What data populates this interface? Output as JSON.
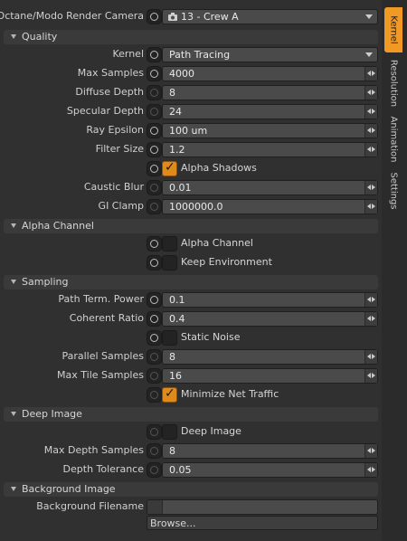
{
  "camera": {
    "label": "Octane/Modo Render Camera",
    "value": "13 - Crew A",
    "icon": "camera-icon"
  },
  "sections": {
    "quality": "Quality",
    "alpha_channel": "Alpha Channel",
    "sampling": "Sampling",
    "deep_image": "Deep Image",
    "background_image": "Background Image"
  },
  "quality": {
    "kernel": {
      "label": "Kernel",
      "value": "Path Tracing"
    },
    "max_samples": {
      "label": "Max Samples",
      "value": "4000"
    },
    "diffuse_depth": {
      "label": "Diffuse Depth",
      "value": "8"
    },
    "specular_depth": {
      "label": "Specular Depth",
      "value": "24"
    },
    "ray_epsilon": {
      "label": "Ray Epsilon",
      "value": "100 um"
    },
    "filter_size": {
      "label": "Filter Size",
      "value": "1.2"
    },
    "alpha_shadows": {
      "label": "Alpha Shadows",
      "checked": true
    },
    "caustic_blur": {
      "label": "Caustic Blur",
      "value": "0.01"
    },
    "gi_clamp": {
      "label": "GI Clamp",
      "value": "1000000.0"
    }
  },
  "alpha_channel": {
    "alpha_channel": {
      "label": "Alpha Channel",
      "checked": false
    },
    "keep_environment": {
      "label": "Keep Environment",
      "checked": false
    }
  },
  "sampling": {
    "path_term_power": {
      "label": "Path Term. Power",
      "value": "0.1"
    },
    "coherent_ratio": {
      "label": "Coherent Ratio",
      "value": "0.4"
    },
    "static_noise": {
      "label": "Static Noise",
      "checked": false
    },
    "parallel_samples": {
      "label": "Parallel Samples",
      "value": "8"
    },
    "max_tile_samples": {
      "label": "Max Tile Samples",
      "value": "16"
    },
    "minimize_net_traffic": {
      "label": "Minimize Net Traffic",
      "checked": true
    }
  },
  "deep_image": {
    "deep_image": {
      "label": "Deep Image",
      "checked": false
    },
    "max_depth_samples": {
      "label": "Max Depth Samples",
      "value": "8"
    },
    "depth_tolerance": {
      "label": "Depth Tolerance",
      "value": "0.05"
    }
  },
  "background_image": {
    "filename": {
      "label": "Background Filename",
      "value": ""
    },
    "browse": "Browse..."
  },
  "side_tabs": [
    "Kernel",
    "Resolution",
    "Animation",
    "Settings"
  ],
  "colors": {
    "accent": "#f09a25",
    "panel": "#303030",
    "field": "#4a4a4a"
  }
}
